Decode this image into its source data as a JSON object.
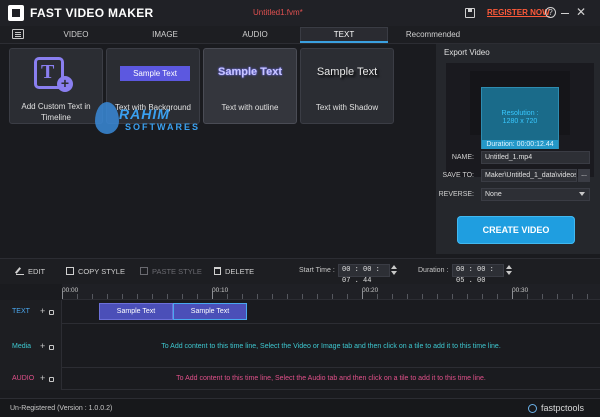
{
  "app": {
    "title": "FAST VIDEO MAKER",
    "file_name": "Untitled1.fvm*",
    "register_label": "REGISTER NOW",
    "help_glyph": "?",
    "close_glyph": "✕"
  },
  "tabs": [
    {
      "label": "VIDEO",
      "active": false
    },
    {
      "label": "IMAGE",
      "active": false
    },
    {
      "label": "AUDIO",
      "active": false
    },
    {
      "label": "TEXT",
      "active": true
    },
    {
      "label": "Recommended",
      "active": false
    }
  ],
  "tiles": [
    {
      "caption": "Add Custom Text in Timeline",
      "icon": "add-text-icon"
    },
    {
      "caption": "Text with Background",
      "sample": "Sample Text"
    },
    {
      "caption": "Text with outline",
      "sample": "Sample Text"
    },
    {
      "caption": "Text with Shadow",
      "sample": "Sample Text"
    }
  ],
  "watermark": {
    "main": "RAHIM",
    "sub": "SOFTWARES"
  },
  "export": {
    "title": "Export Video",
    "resolution_label": "Resolution :",
    "resolution_value": "1280 x 720",
    "duration_label": "Duration: 00:00:12.44",
    "name_label": "NAME:",
    "name_value": "Untitled_1.mp4",
    "save_to_label": "SAVE TO:",
    "save_to_value": "Maker\\Untitled_1_data\\videos",
    "browse_label": "...",
    "reverse_label": "REVERSE:",
    "reverse_value": "None",
    "create_label": "CREATE VIDEO"
  },
  "toolbar": {
    "edit": "EDIT",
    "copy_style": "COPY STYLE",
    "paste_style": "PASTE STYLE",
    "delete": "DELETE",
    "start_time_label": "Start Time :",
    "start_time_value": "00 : 00 : 07 . 44",
    "duration_label": "Duration :",
    "duration_value": "00 : 00 : 05 . 00"
  },
  "timeline": {
    "ruler": [
      "00:00",
      "00:10",
      "00:20",
      "00:30"
    ],
    "tracks": [
      {
        "name": "TEXT",
        "color": "#4aa8f0"
      },
      {
        "name": "Media",
        "color": "#3ec8d0",
        "message": "To Add content to this time line, Select the Video or Image tab and then click on a tile to add it to this time line."
      },
      {
        "name": "AUDIO",
        "color": "#e0508a",
        "message": "To Add content to this time line, Select the Audio tab and then click on a tile to add it to this time line."
      }
    ],
    "clips": [
      "Sample Text",
      "Sample Text"
    ]
  },
  "status": {
    "version": "Un-Registered (Version : 1.0.0.2)",
    "brand": "fastpctools"
  },
  "colors": {
    "accent": "#1f9ee0",
    "register": "#ff5a3a",
    "title_file": "#e05050",
    "media_msg": "#3ec8d0",
    "audio_msg": "#e0508a"
  }
}
